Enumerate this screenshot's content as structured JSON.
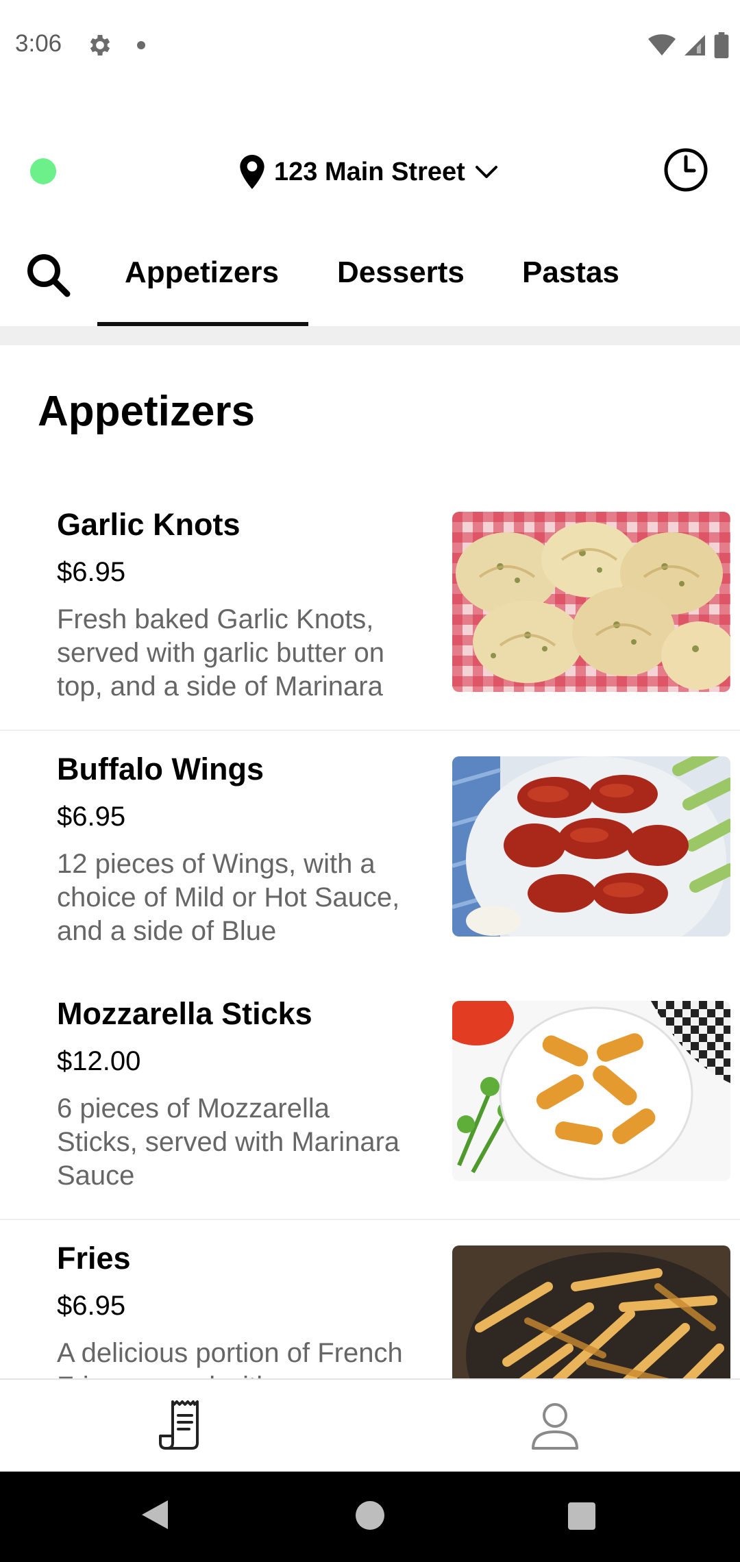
{
  "status_bar": {
    "time": "3:06",
    "icons": [
      "gear-icon",
      "notification-dot",
      "wifi-icon",
      "signal-icon",
      "battery-icon"
    ]
  },
  "header": {
    "address": "123 Main Street",
    "status_color": "#6cf08a",
    "icons": [
      "location-pin-icon",
      "chevron-down-icon",
      "clock-icon"
    ]
  },
  "tabs": {
    "items": [
      {
        "label": "Appetizers",
        "selected": true
      },
      {
        "label": "Desserts",
        "selected": false
      },
      {
        "label": "Pastas",
        "selected": false
      }
    ]
  },
  "section": {
    "title": "Appetizers"
  },
  "menu_items": [
    {
      "name": "Garlic Knots",
      "price": "$6.95",
      "description": "Fresh baked Garlic Knots, served with garlic butter on top, and a side of Marinara"
    },
    {
      "name": "Buffalo Wings",
      "price": "$6.95",
      "description": "12 pieces of Wings, with a choice of Mild or Hot Sauce, and a side of Blue"
    },
    {
      "name": "Mozzarella Sticks",
      "price": "$12.00",
      "description": "6 pieces of Mozzarella Sticks, served with Marinara Sauce"
    },
    {
      "name": "Fries",
      "price": "$6.95",
      "description": "A delicious portion of French Fries, served with"
    }
  ],
  "bottom_nav": {
    "items": [
      "menu-receipt-icon",
      "profile-icon"
    ]
  },
  "system_nav": {
    "items": [
      "back-icon",
      "home-icon",
      "recents-icon"
    ]
  }
}
